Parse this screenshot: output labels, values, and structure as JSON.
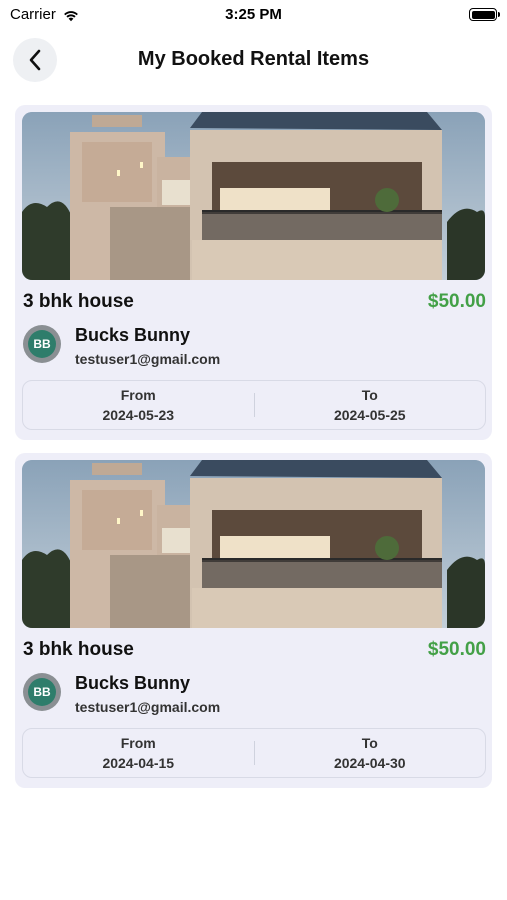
{
  "status_bar": {
    "carrier": "Carrier",
    "time": "3:25 PM"
  },
  "header": {
    "title": "My Booked Rental Items"
  },
  "bookings": [
    {
      "title": "3 bhk house",
      "price": "$50.00",
      "owner_initials": "BB",
      "owner_name": "Bucks Bunny",
      "owner_email": "testuser1@gmail.com",
      "from_label": "From",
      "from_date": "2024-05-23",
      "to_label": "To",
      "to_date": "2024-05-25"
    },
    {
      "title": "3 bhk house",
      "price": "$50.00",
      "owner_initials": "BB",
      "owner_name": "Bucks Bunny",
      "owner_email": "testuser1@gmail.com",
      "from_label": "From",
      "from_date": "2024-04-15",
      "to_label": "To",
      "to_date": "2024-04-30"
    }
  ],
  "colors": {
    "price": "#43a047",
    "card_bg": "#eeeef8",
    "avatar_bg": "#2e7d6b"
  },
  "icons": {
    "back": "chevron-left-icon",
    "wifi": "wifi-icon",
    "battery": "battery-icon"
  }
}
